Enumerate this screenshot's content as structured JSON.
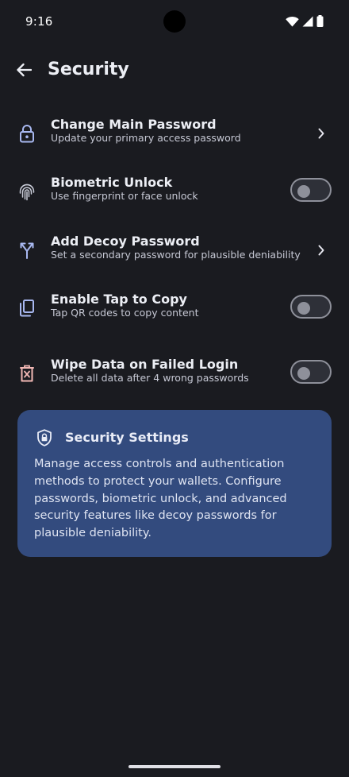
{
  "status_bar": {
    "time": "9:16"
  },
  "app_bar": {
    "title": "Security",
    "back_icon": "arrow-back-icon"
  },
  "settings": [
    {
      "title": "Change Main Password",
      "subtitle": "Update your primary access password",
      "icon": "lock-icon",
      "control": "chevron"
    },
    {
      "title": "Biometric Unlock",
      "subtitle": "Use fingerprint or face unlock",
      "icon": "fingerprint-icon",
      "control": "toggle",
      "enabled": false
    },
    {
      "title": "Add Decoy Password",
      "subtitle": "Set a secondary password for plausible deniability",
      "icon": "split-arrows-icon",
      "control": "chevron"
    },
    {
      "title": "Enable Tap to Copy",
      "subtitle": "Tap QR codes to copy content",
      "icon": "copy-icon",
      "control": "toggle",
      "enabled": false
    },
    {
      "title": "Wipe Data on Failed Login",
      "subtitle": "Delete all data after 4 wrong passwords",
      "icon": "delete-forever-icon",
      "control": "toggle",
      "enabled": false
    }
  ],
  "info_card": {
    "icon": "shield-lock-icon",
    "title": "Security Settings",
    "body": "Manage access controls and authentication methods to protect your wallets. Configure passwords, biometric unlock, and advanced security features like decoy passwords for plausible deniability."
  },
  "colors": {
    "background": "#1a1b20",
    "icon_tint": "#a8b8f0",
    "danger_tint": "#f2b8b5",
    "card_background": "#334b7e",
    "toggle_off": "#8e909a"
  }
}
